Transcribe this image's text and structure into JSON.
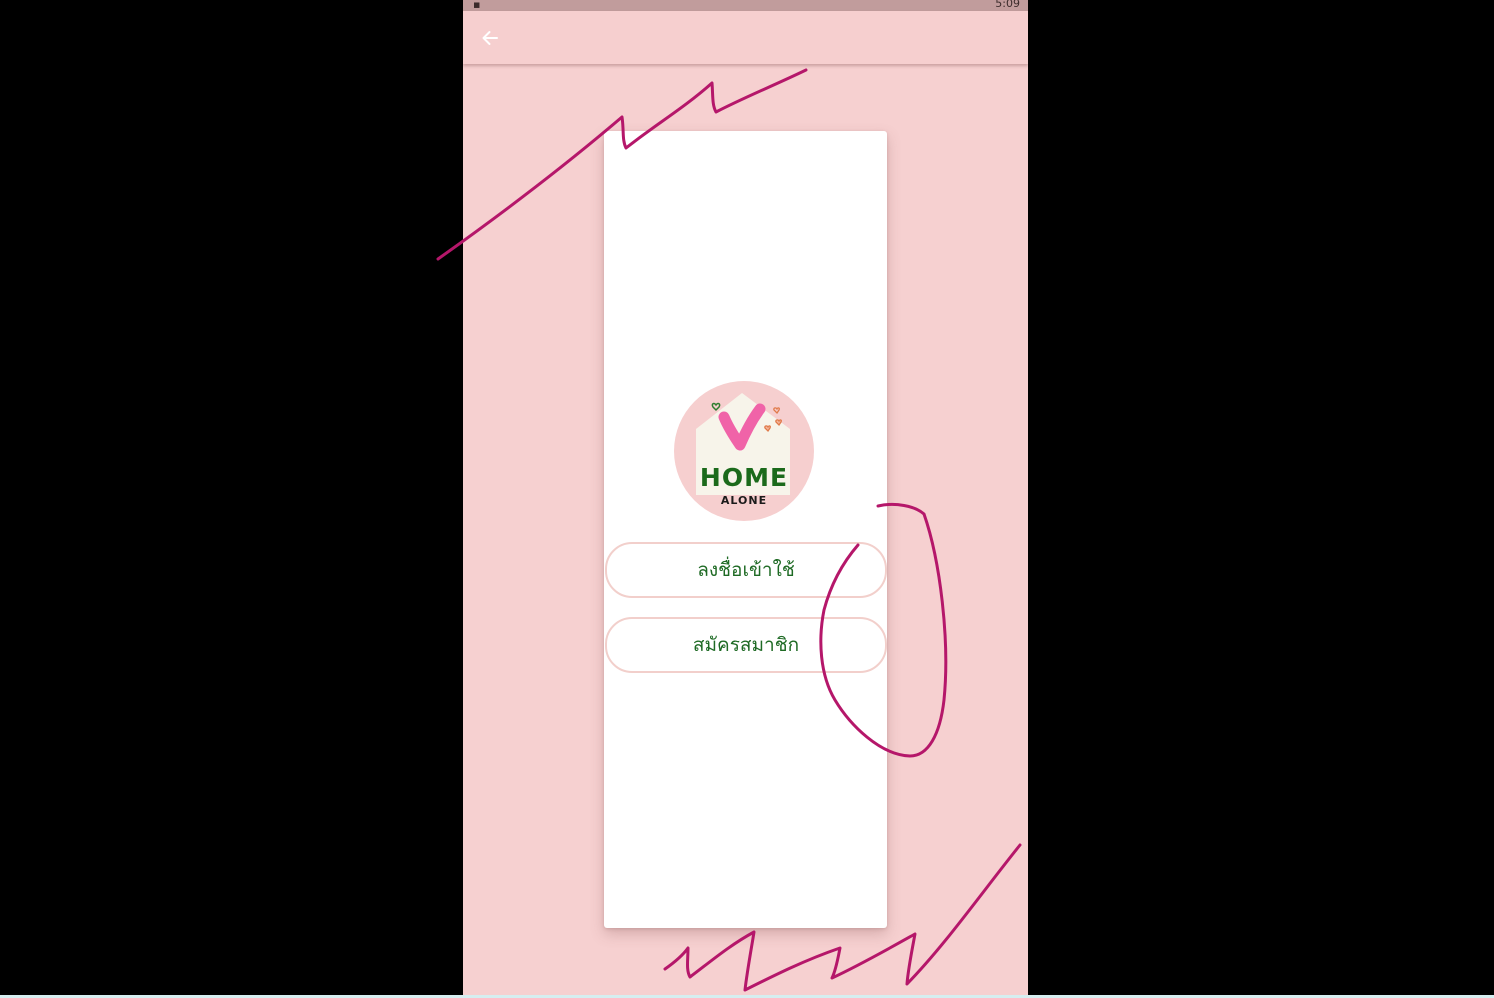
{
  "status_bar": {
    "time": "5:09"
  },
  "app_bar": {
    "back_icon": "arrow-left-icon"
  },
  "logo": {
    "title": "HOME",
    "subtitle": "ALONE"
  },
  "buttons": {
    "login": "ลงชื่อเข้าใช้",
    "register": "สมัครสมาชิก"
  },
  "colors": {
    "background": "#f6d0d0",
    "card": "#ffffff",
    "button_text": "#1e6a24",
    "button_border": "#f2cfcb",
    "annotation_ink": "#b5176a"
  }
}
